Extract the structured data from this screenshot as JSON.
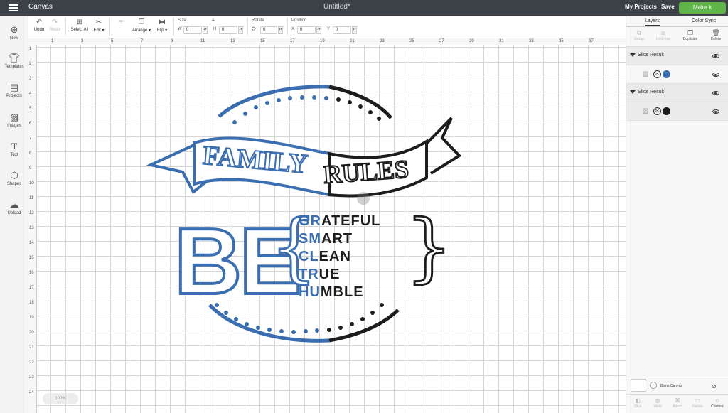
{
  "topbar": {
    "app_title": "Canvas",
    "doc_title": "Untitled*",
    "my_projects": "My Projects",
    "save": "Save",
    "make_it": "Make It"
  },
  "toolbar": {
    "undo": "Undo",
    "redo": "Redo",
    "select_all": "Select All",
    "edit": "Edit",
    "arrange": "Arrange",
    "flip": "Flip",
    "size_label": "Size",
    "width_prefix": "W",
    "width_value": "0",
    "height_prefix": "H",
    "height_value": "0",
    "rotate_label": "Rotate",
    "rotate_value": "0",
    "position_label": "Position",
    "x_prefix": "X",
    "x_value": "0",
    "y_prefix": "Y",
    "y_value": "0"
  },
  "leftbar": [
    {
      "label": "New",
      "icon": "plus-icon"
    },
    {
      "label": "Templates",
      "icon": "shirt-icon"
    },
    {
      "label": "Projects",
      "icon": "projects-icon"
    },
    {
      "label": "Images",
      "icon": "image-icon"
    },
    {
      "label": "Text",
      "icon": "text-icon"
    },
    {
      "label": "Shapes",
      "icon": "shapes-icon"
    },
    {
      "label": "Upload",
      "icon": "upload-icon"
    }
  ],
  "rulers": {
    "top": [
      "1",
      "3",
      "5",
      "7",
      "9",
      "11",
      "13",
      "15",
      "17",
      "19",
      "21",
      "23",
      "25",
      "27",
      "29",
      "31",
      "33",
      "35",
      "37"
    ],
    "left": [
      "1",
      "2",
      "3",
      "4",
      "5",
      "6",
      "7",
      "8",
      "9",
      "10",
      "11",
      "12",
      "13",
      "14",
      "15",
      "16",
      "17",
      "18",
      "19",
      "20",
      "21",
      "22",
      "23",
      "24"
    ]
  },
  "design": {
    "banner_left": "FAMILY",
    "banner_right": "RULES",
    "be": "BE",
    "words": [
      {
        "blue": "GR",
        "black": "ATEFUL"
      },
      {
        "blue": "SM",
        "black": "ART"
      },
      {
        "blue": "CL",
        "black": "EAN"
      },
      {
        "blue": "TR",
        "black": "UE"
      },
      {
        "blue": "HU",
        "black": "MBLE"
      }
    ],
    "colors": {
      "blue": "#3a6eb0",
      "black": "#1d1d1d"
    }
  },
  "zoom": "100%",
  "rightpanel": {
    "tabs": [
      "Layers",
      "Color Sync"
    ],
    "tools": [
      "Group",
      "UnGroup",
      "Duplicate",
      "Delete"
    ],
    "layers": [
      {
        "group": "Slice Result",
        "color": "#3a6eb0"
      },
      {
        "group": "Slice Result",
        "color": "#1d1d1d"
      }
    ],
    "blank_canvas": "Blank Canvas",
    "bottom_tools": [
      "Slice",
      "Weld",
      "Attach",
      "Flatten",
      "Contour"
    ]
  }
}
